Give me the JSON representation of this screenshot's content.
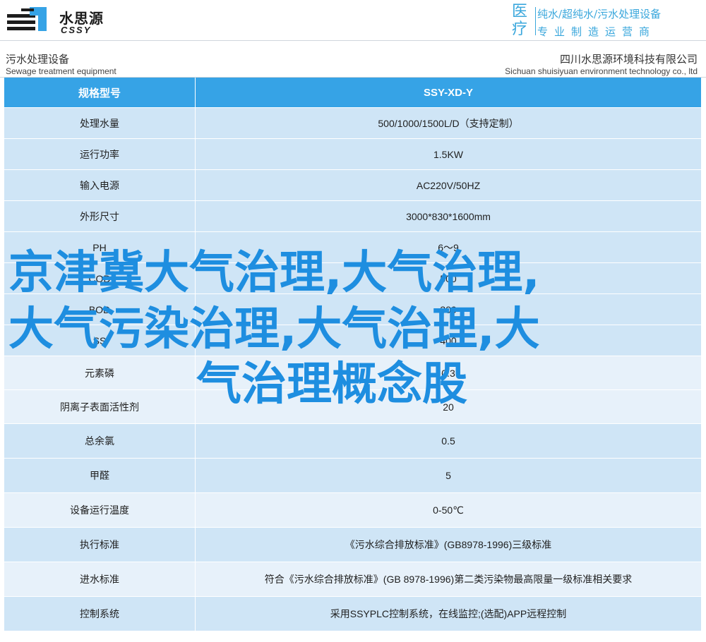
{
  "header": {
    "logo_cn": "水思源",
    "logo_en": "CSSY",
    "med_label": "医\n疗",
    "tagline": "纯水/超纯水/污水处理设备",
    "slogan": "专业制造运营商"
  },
  "subheader": {
    "left_cn": "污水处理设备",
    "left_en": "Sewage treatment equipment",
    "right_cn": "四川水思源环境科技有限公司",
    "right_en": "Sichuan shuisiyuan environment technology co., ltd"
  },
  "colors": {
    "accent": "#36a3e6",
    "row_dark": "#cfe5f6",
    "row_light": "#e7f1fa",
    "overlay_text": "#1e8ee0"
  },
  "table": {
    "rows": [
      {
        "label": "规格型号",
        "value": "SSY-XD-Y"
      },
      {
        "label": "处理水量",
        "value": "500/1000/1500L/D（支持定制）"
      },
      {
        "label": "运行功率",
        "value": "1.5KW"
      },
      {
        "label": "输入电源",
        "value": "AC220V/50HZ"
      },
      {
        "label": "外形尺寸",
        "value": "3000*830*1600mm"
      },
      {
        "label": "PH",
        "value": "6～9"
      },
      {
        "label": "COD",
        "value": "500"
      },
      {
        "label": "BOD",
        "value": "300"
      },
      {
        "label": "SS",
        "value": "400"
      },
      {
        "label": "元素磷",
        "value": "0.3"
      },
      {
        "label": "阴离子表面活性剂",
        "value": "20"
      },
      {
        "label": "总余氯",
        "value": "0.5"
      },
      {
        "label": "甲醛",
        "value": "5"
      },
      {
        "label": "设备运行温度",
        "value": "0-50℃"
      },
      {
        "label": "执行标准",
        "value": "《污水综合排放标准》(GB8978-1996)三级标准"
      },
      {
        "label": "进水标准",
        "value": "符合《污水综合排放标准》(GB 8978-1996)第二类污染物最高限量一级标准相关要求"
      },
      {
        "label": "控制系统",
        "value": "采用SSYPLC控制系统，在线监控;(选配)APP远程控制"
      }
    ]
  },
  "overlay": {
    "line1": "京津冀大气治理,大气治理,",
    "line2": "大气污染治理,大气治理,大",
    "line3": "气治理概念股"
  }
}
